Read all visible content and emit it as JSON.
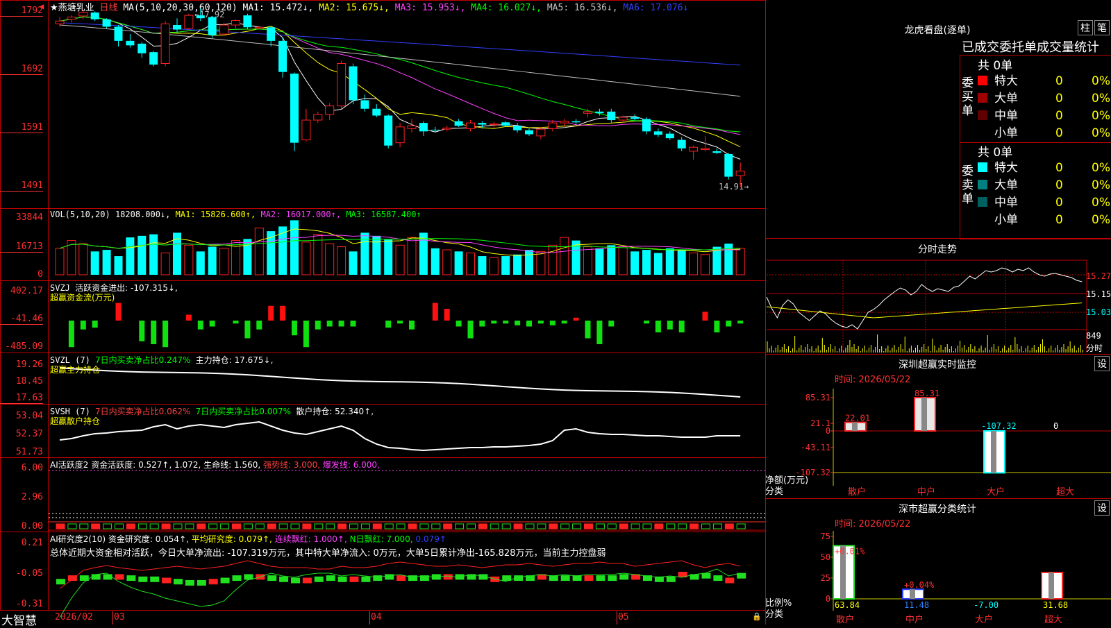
{
  "header": {
    "stock_name": "★燕塘乳业",
    "period": "日线",
    "ma_params": "MA(5,10,20,30,60,120)",
    "ma1": "MA1: 15.472↓,",
    "ma2": "MA2: 15.675↓,",
    "ma3": "MA3: 15.953↓,",
    "ma4": "MA4: 16.027↓,",
    "ma5": "MA5: 16.536↓,",
    "ma6": "MA6: 17.076↓",
    "high_note": "←17.92",
    "low_note": "14.91→"
  },
  "price_axis": [
    "1792",
    "1692",
    "1591",
    "1491"
  ],
  "vol_panel": {
    "label": "VOL(5,10,20)",
    "value": "18208.000↓,",
    "ma1": "MA1: 15826.600↑,",
    "ma2": "MA2: 16017.000↑,",
    "ma3": "MA3: 16587.400↑",
    "axis": [
      "33844",
      "16713",
      "0"
    ]
  },
  "svzj_panel": {
    "label": "SVZJ",
    "text1": "活跃资金进出: -107.315↓,",
    "text2": "超赢资金流(万元)",
    "axis": [
      "402.17",
      "-41.46",
      "-485.09"
    ]
  },
  "svzl_panel": {
    "label": "SVZL (7)",
    "text1": "7日内买卖净占比0.247%",
    "text2": "主力持仓: 17.675↓,",
    "text3": "超赢主力持仓",
    "axis": [
      "19.26",
      "18.45",
      "17.63"
    ]
  },
  "svsh_panel": {
    "label": "SVSH (7)",
    "text1": "7日内买卖净占比0.062%",
    "text2": "7日内买卖净占比0.007%",
    "text3": "散户持仓: 52.340↑,",
    "text4": "超赢散户持仓",
    "axis": [
      "53.04",
      "52.37",
      "51.73"
    ]
  },
  "ai_active_panel": {
    "label": "AI活跃度2",
    "text1": "资金活跃度: 0.527↑,",
    "text2": "1.072,",
    "text3": "生命线: 1.560,",
    "text4": "强势线: 3.000,",
    "text5": "爆发线: 6.000,",
    "axis": [
      "6.00",
      "2.96",
      "0.00"
    ]
  },
  "ai_research_panel": {
    "label": "AI研究度2(10)",
    "text1": "资金研究度: 0.054↑,",
    "text2": "平均研究度: 0.079↑,",
    "text3": "连续飘红: 1.000↑,",
    "text4": "N日飘红: 7.000,",
    "text5": "0.079↑",
    "summary": "总体近期大资金相对活跃，今日大单净流出: -107.319万元，其中特大单净流入: 0万元，大单5日累计净出-165.828万元，当前主力控盘弱",
    "axis": [
      "0.21",
      "-0.05",
      "-0.31"
    ]
  },
  "bottom_bar": {
    "brand": "大智慧",
    "dates": [
      "2026/02",
      "03",
      "04",
      "05"
    ]
  },
  "right_panel": {
    "dragon_title": "龙虎看盘(逐单)",
    "btn_bar": "柱",
    "btn_pen": "笔",
    "stats_title": "已成交委托单成交量统计",
    "buy_total": "共 0单",
    "buy_label": "委买单",
    "sell_total": "共 0单",
    "sell_label": "委卖单",
    "buy_rows": [
      {
        "label": "特大",
        "value": "0",
        "pct": "0%",
        "color": "#ff0000"
      },
      {
        "label": "大单",
        "value": "0",
        "pct": "0%",
        "color": "#a00000"
      },
      {
        "label": "中单",
        "value": "0",
        "pct": "0%",
        "color": "#600000"
      },
      {
        "label": "小单",
        "value": "0",
        "pct": "0%",
        "color": ""
      }
    ],
    "sell_rows": [
      {
        "label": "特大",
        "value": "0",
        "pct": "0%",
        "color": "#00ffff"
      },
      {
        "label": "大单",
        "value": "0",
        "pct": "0%",
        "color": "#008080"
      },
      {
        "label": "中单",
        "value": "0",
        "pct": "0%",
        "color": "#006060"
      },
      {
        "label": "小单",
        "value": "0",
        "pct": "0%",
        "color": ""
      }
    ],
    "intraday_title": "分时走势",
    "intraday_axis": [
      "15.27",
      "15.15",
      "15.03"
    ],
    "intraday_vol": "849",
    "intraday_vol_label": "分时",
    "sz_monitor_title": "深圳超赢实时监控",
    "sz_monitor_btn": "设",
    "sz_monitor_time": "时间: 2026/05/22",
    "sz_monitor_axis": [
      "85.31",
      "21.1",
      "0",
      "-43.11",
      "-107.32"
    ],
    "sz_monitor_ylabel": "净额(万元)",
    "sz_monitor_xlabel": "分类",
    "sz_monitor_bars": [
      {
        "cat": "散户",
        "value": 22.01,
        "label": "22.01"
      },
      {
        "cat": "中户",
        "value": 85.31,
        "label": "85.31"
      },
      {
        "cat": "大户",
        "value": -107.32,
        "label": "-107.32"
      },
      {
        "cat": "超大",
        "value": 0,
        "label": "0"
      }
    ],
    "sz_class_title": "深市超赢分类统计",
    "sz_class_btn": "设",
    "sz_class_time": "时间: 2026/05/22",
    "sz_class_axis": [
      "75",
      "50",
      "25",
      "0"
    ],
    "sz_class_ylabel": "比例%",
    "sz_class_xlabel": "分类",
    "sz_class_bars": [
      {
        "cat": "散户",
        "value": 63.84,
        "label": "63.84",
        "top": "+0.01%"
      },
      {
        "cat": "中户",
        "value": 11.48,
        "label": "11.48",
        "top": "+0.04%"
      },
      {
        "cat": "大户",
        "value": -7.0,
        "label": "-7.00",
        "top": ""
      },
      {
        "cat": "超大",
        "value": 31.68,
        "label": "31.68",
        "top": ""
      }
    ]
  },
  "colors": {
    "up": "#ff2020",
    "down": "#00ffff",
    "ma1": "#ffffff",
    "ma2": "#ffff00",
    "ma3": "#ff40ff",
    "ma4": "#00ff00",
    "ma5": "#c0c0c0",
    "ma6": "#3040ff",
    "border": "#c00000"
  },
  "chart_data": {
    "type": "candlestick",
    "title": "",
    "candles": [
      {
        "o": 17.8,
        "h": 17.92,
        "l": 17.75,
        "c": 17.85
      },
      {
        "o": 17.88,
        "h": 17.95,
        "l": 17.82,
        "c": 17.92
      },
      {
        "o": 17.94,
        "h": 18.05,
        "l": 17.88,
        "c": 18.0
      },
      {
        "o": 18.0,
        "h": 18.02,
        "l": 17.85,
        "c": 17.88
      },
      {
        "o": 17.88,
        "h": 17.9,
        "l": 17.72,
        "c": 17.75
      },
      {
        "o": 17.75,
        "h": 17.78,
        "l": 17.4,
        "c": 17.5
      },
      {
        "o": 17.5,
        "h": 17.62,
        "l": 17.38,
        "c": 17.42
      },
      {
        "o": 17.45,
        "h": 17.48,
        "l": 17.2,
        "c": 17.28
      },
      {
        "o": 17.3,
        "h": 17.32,
        "l": 17.05,
        "c": 17.08
      },
      {
        "o": 17.1,
        "h": 17.85,
        "l": 17.05,
        "c": 17.8
      },
      {
        "o": 17.78,
        "h": 17.9,
        "l": 17.65,
        "c": 17.7
      },
      {
        "o": 17.72,
        "h": 17.98,
        "l": 17.7,
        "c": 17.95
      },
      {
        "o": 17.95,
        "h": 18.08,
        "l": 17.85,
        "c": 17.9
      },
      {
        "o": 17.92,
        "h": 17.94,
        "l": 17.55,
        "c": 17.6
      },
      {
        "o": 17.62,
        "h": 17.82,
        "l": 17.6,
        "c": 17.78
      },
      {
        "o": 17.78,
        "h": 17.88,
        "l": 17.72,
        "c": 17.86
      },
      {
        "o": 17.95,
        "h": 17.98,
        "l": 17.7,
        "c": 17.74
      },
      {
        "o": 17.72,
        "h": 17.76,
        "l": 17.7,
        "c": 17.74
      },
      {
        "o": 17.74,
        "h": 17.76,
        "l": 17.4,
        "c": 17.5
      },
      {
        "o": 17.5,
        "h": 17.55,
        "l": 16.85,
        "c": 16.95
      },
      {
        "o": 16.92,
        "h": 16.94,
        "l": 15.55,
        "c": 15.7
      },
      {
        "o": 15.75,
        "h": 16.3,
        "l": 15.72,
        "c": 16.1
      },
      {
        "o": 16.1,
        "h": 16.25,
        "l": 16.05,
        "c": 16.2
      },
      {
        "o": 16.2,
        "h": 16.4,
        "l": 16.1,
        "c": 16.35
      },
      {
        "o": 16.35,
        "h": 17.15,
        "l": 16.3,
        "c": 17.1
      },
      {
        "o": 17.05,
        "h": 17.1,
        "l": 16.38,
        "c": 16.45
      },
      {
        "o": 16.45,
        "h": 16.55,
        "l": 16.25,
        "c": 16.3
      },
      {
        "o": 16.3,
        "h": 16.38,
        "l": 16.15,
        "c": 16.18
      },
      {
        "o": 16.18,
        "h": 16.2,
        "l": 15.6,
        "c": 15.65
      },
      {
        "o": 15.7,
        "h": 16.05,
        "l": 15.62,
        "c": 15.98
      },
      {
        "o": 15.95,
        "h": 16.12,
        "l": 15.88,
        "c": 16.0
      },
      {
        "o": 16.05,
        "h": 16.08,
        "l": 15.82,
        "c": 15.9
      },
      {
        "o": 15.93,
        "h": 15.98,
        "l": 15.88,
        "c": 15.92
      },
      {
        "o": 15.94,
        "h": 16.0,
        "l": 15.9,
        "c": 15.96
      },
      {
        "o": 16.08,
        "h": 16.12,
        "l": 15.98,
        "c": 16.0
      },
      {
        "o": 15.95,
        "h": 16.1,
        "l": 15.9,
        "c": 16.05
      },
      {
        "o": 16.05,
        "h": 16.08,
        "l": 15.95,
        "c": 16.02
      },
      {
        "o": 16.02,
        "h": 16.07,
        "l": 15.97,
        "c": 16.03
      },
      {
        "o": 16.06,
        "h": 16.08,
        "l": 15.98,
        "c": 16.0
      },
      {
        "o": 16.0,
        "h": 16.05,
        "l": 15.88,
        "c": 15.92
      },
      {
        "o": 15.92,
        "h": 15.95,
        "l": 15.82,
        "c": 15.85
      },
      {
        "o": 15.82,
        "h": 15.98,
        "l": 15.76,
        "c": 15.94
      },
      {
        "o": 15.95,
        "h": 16.1,
        "l": 15.9,
        "c": 16.05
      },
      {
        "o": 16.05,
        "h": 16.12,
        "l": 16.0,
        "c": 16.08
      },
      {
        "o": 16.08,
        "h": 16.12,
        "l": 16.02,
        "c": 16.06
      },
      {
        "o": 16.22,
        "h": 16.3,
        "l": 16.15,
        "c": 16.25
      },
      {
        "o": 16.25,
        "h": 16.3,
        "l": 16.18,
        "c": 16.22
      },
      {
        "o": 16.25,
        "h": 16.3,
        "l": 16.05,
        "c": 16.1
      },
      {
        "o": 16.1,
        "h": 16.18,
        "l": 16.05,
        "c": 16.15
      },
      {
        "o": 16.15,
        "h": 16.2,
        "l": 16.08,
        "c": 16.12
      },
      {
        "o": 16.12,
        "h": 16.15,
        "l": 15.85,
        "c": 15.9
      },
      {
        "o": 15.9,
        "h": 15.95,
        "l": 15.8,
        "c": 15.84
      },
      {
        "o": 15.86,
        "h": 15.9,
        "l": 15.75,
        "c": 15.78
      },
      {
        "o": 15.75,
        "h": 15.8,
        "l": 15.55,
        "c": 15.6
      },
      {
        "o": 15.55,
        "h": 15.65,
        "l": 15.4,
        "c": 15.62
      },
      {
        "o": 15.58,
        "h": 15.82,
        "l": 15.55,
        "c": 15.6
      },
      {
        "o": 15.55,
        "h": 15.6,
        "l": 15.5,
        "c": 15.52
      },
      {
        "o": 15.5,
        "h": 15.52,
        "l": 15.05,
        "c": 15.1
      },
      {
        "o": 15.12,
        "h": 15.35,
        "l": 14.91,
        "c": 15.2
      }
    ]
  }
}
